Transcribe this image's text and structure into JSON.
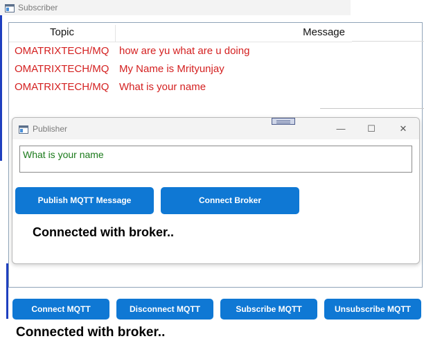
{
  "subscriber": {
    "title": "Subscriber",
    "table": {
      "headers": [
        "Topic",
        "Message"
      ],
      "rows": [
        {
          "topic": "OMATRIXTECH/MQ",
          "message": "how are yu what are u doing"
        },
        {
          "topic": "OMATRIXTECH/MQ",
          "message": "My Name is Mrityunjay"
        },
        {
          "topic": "OMATRIXTECH/MQ",
          "message": "What is your name"
        }
      ]
    },
    "buttons": {
      "connect": "Connect MQTT",
      "disconnect": "Disconnect MQTT",
      "subscribe": "Subscribe MQTT",
      "unsubscribe": "Unsubscribe MQTT"
    },
    "status": "Connected with broker.."
  },
  "publisher": {
    "title": "Publisher",
    "window_controls": {
      "minimize": "—",
      "maximize": "☐",
      "close": "✕"
    },
    "input_value": "What is your name",
    "buttons": {
      "publish": "Publish MQTT Message",
      "connect_broker": "Connect Broker"
    },
    "status": "Connected with broker.."
  },
  "colors": {
    "accent": "#0f78d4",
    "row_text": "#d42020",
    "input_text": "#1a7a1a"
  }
}
